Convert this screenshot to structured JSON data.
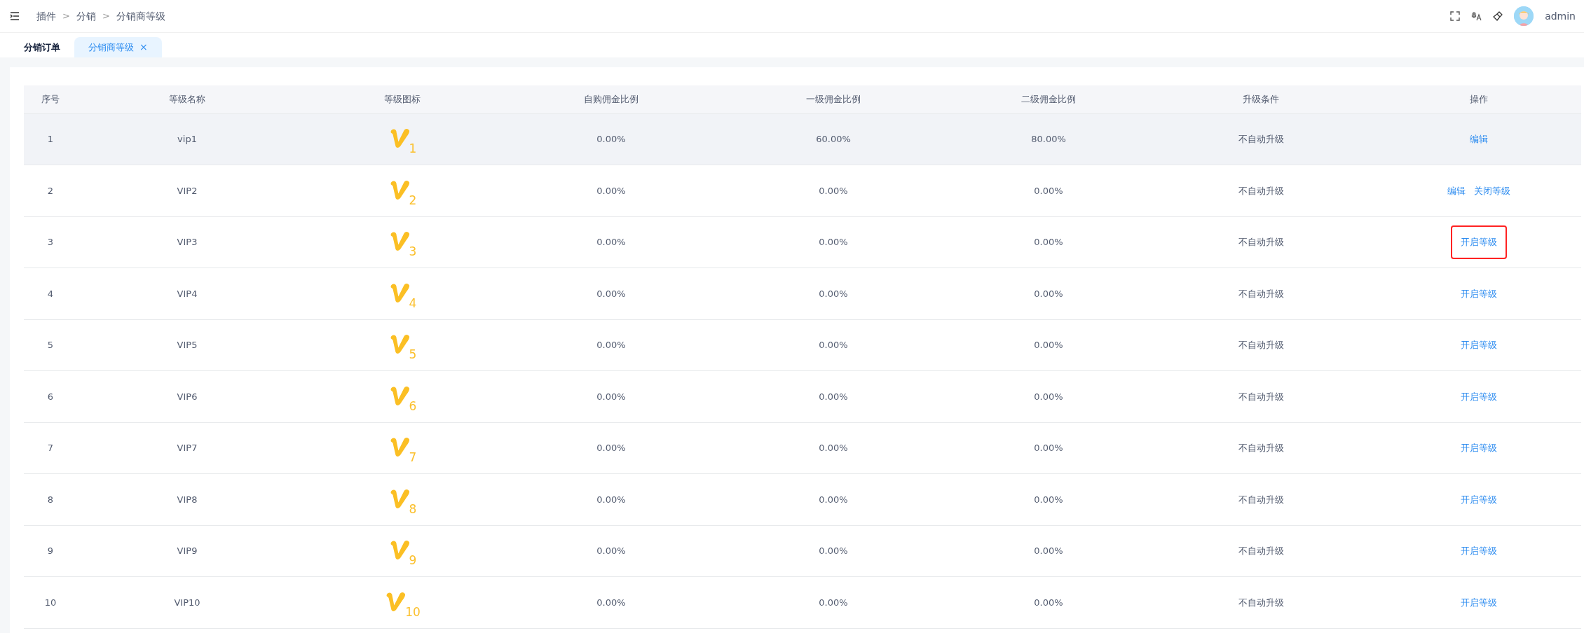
{
  "breadcrumb": [
    {
      "label": "插件",
      "separator": ">"
    },
    {
      "label": "分销",
      "separator": ">"
    },
    {
      "label": "分销商等级"
    }
  ],
  "user": {
    "name": "admin"
  },
  "tabs": [
    {
      "label": "分销订单",
      "selected": false
    },
    {
      "label": "分销商等级",
      "selected": true,
      "close": "×"
    }
  ],
  "table": {
    "columns": [
      "序号",
      "等级名称",
      "等级图标",
      "自购佣金比例",
      "一级佣金比例",
      "二级佣金比例",
      "升级条件",
      "操作"
    ],
    "rows": [
      {
        "index": "1",
        "name": "vip1",
        "icon_number": "1",
        "self_rate": "0.00%",
        "level1_rate": "60.00%",
        "level2_rate": "80.00%",
        "upgrade": "不自动升级",
        "hovered": true,
        "actions": [
          {
            "label": "编辑",
            "highlighted": false
          }
        ]
      },
      {
        "index": "2",
        "name": "VIP2",
        "icon_number": "2",
        "self_rate": "0.00%",
        "level1_rate": "0.00%",
        "level2_rate": "0.00%",
        "upgrade": "不自动升级",
        "hovered": false,
        "actions": [
          {
            "label": "编辑",
            "highlighted": false
          },
          {
            "label": "关闭等级",
            "highlighted": false
          }
        ]
      },
      {
        "index": "3",
        "name": "VIP3",
        "icon_number": "3",
        "self_rate": "0.00%",
        "level1_rate": "0.00%",
        "level2_rate": "0.00%",
        "upgrade": "不自动升级",
        "hovered": false,
        "actions": [
          {
            "label": "开启等级",
            "highlighted": true
          }
        ]
      },
      {
        "index": "4",
        "name": "VIP4",
        "icon_number": "4",
        "self_rate": "0.00%",
        "level1_rate": "0.00%",
        "level2_rate": "0.00%",
        "upgrade": "不自动升级",
        "hovered": false,
        "actions": [
          {
            "label": "开启等级",
            "highlighted": false
          }
        ]
      },
      {
        "index": "5",
        "name": "VIP5",
        "icon_number": "5",
        "self_rate": "0.00%",
        "level1_rate": "0.00%",
        "level2_rate": "0.00%",
        "upgrade": "不自动升级",
        "hovered": false,
        "actions": [
          {
            "label": "开启等级",
            "highlighted": false
          }
        ]
      },
      {
        "index": "6",
        "name": "VIP6",
        "icon_number": "6",
        "self_rate": "0.00%",
        "level1_rate": "0.00%",
        "level2_rate": "0.00%",
        "upgrade": "不自动升级",
        "hovered": false,
        "actions": [
          {
            "label": "开启等级",
            "highlighted": false
          }
        ]
      },
      {
        "index": "7",
        "name": "VIP7",
        "icon_number": "7",
        "self_rate": "0.00%",
        "level1_rate": "0.00%",
        "level2_rate": "0.00%",
        "upgrade": "不自动升级",
        "hovered": false,
        "actions": [
          {
            "label": "开启等级",
            "highlighted": false
          }
        ]
      },
      {
        "index": "8",
        "name": "VIP8",
        "icon_number": "8",
        "self_rate": "0.00%",
        "level1_rate": "0.00%",
        "level2_rate": "0.00%",
        "upgrade": "不自动升级",
        "hovered": false,
        "actions": [
          {
            "label": "开启等级",
            "highlighted": false
          }
        ]
      },
      {
        "index": "9",
        "name": "VIP9",
        "icon_number": "9",
        "self_rate": "0.00%",
        "level1_rate": "0.00%",
        "level2_rate": "0.00%",
        "upgrade": "不自动升级",
        "hovered": false,
        "actions": [
          {
            "label": "开启等级",
            "highlighted": false
          }
        ]
      },
      {
        "index": "10",
        "name": "VIP10",
        "icon_number": "10",
        "self_rate": "0.00%",
        "level1_rate": "0.00%",
        "level2_rate": "0.00%",
        "upgrade": "不自动升级",
        "hovered": false,
        "actions": [
          {
            "label": "开启等级",
            "highlighted": false
          }
        ]
      }
    ]
  }
}
